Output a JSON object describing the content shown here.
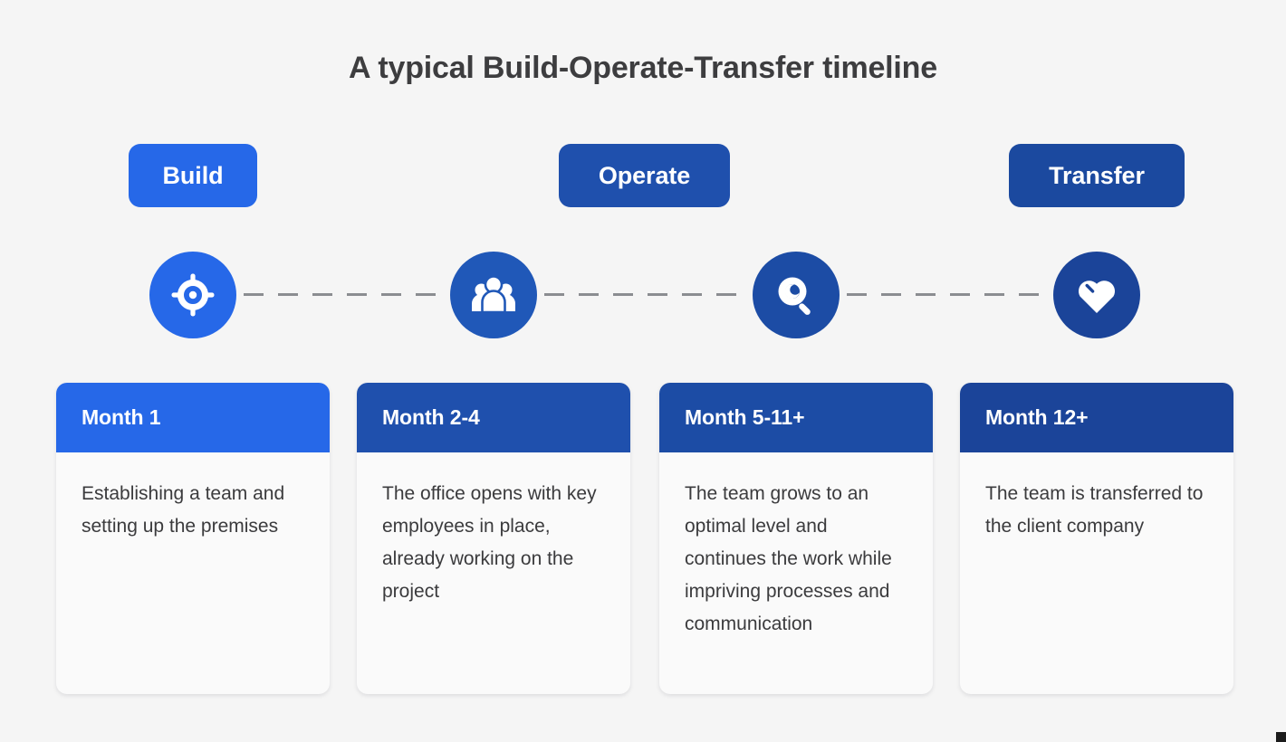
{
  "page": {
    "title": "A typical Build-Operate-Transfer timeline",
    "background_color": "#f5f5f5"
  },
  "phases": [
    {
      "label": "Build",
      "color": "#2668e8"
    },
    {
      "label": "Operate",
      "color": "#1f50ad"
    },
    {
      "label": "Transfer",
      "color": "#1b499f"
    }
  ],
  "timeline": {
    "connector_color": "#8b8d91",
    "connector_style": "dashed",
    "nodes": [
      {
        "icon": "target-icon",
        "color": "#2668e8"
      },
      {
        "icon": "people-group-icon",
        "color": "#2058b8"
      },
      {
        "icon": "magnifier-eye-icon",
        "color": "#1c4ca5"
      },
      {
        "icon": "heart-icon",
        "color": "#1b4499"
      }
    ]
  },
  "cards": [
    {
      "heading": "Month 1",
      "body": "Establishing a team and setting up the premises",
      "header_color": "#2668e8"
    },
    {
      "heading": "Month 2-4",
      "body": "The office opens with key employees in place, already working on the project",
      "header_color": "#1f50ad"
    },
    {
      "heading": "Month 5-11+",
      "body": "The team grows to an optimal level and continues the work while impriving processes and communication",
      "header_color": "#1c4ca5"
    },
    {
      "heading": "Month 12+",
      "body": "The team is transferred to the client company",
      "header_color": "#1b4499"
    }
  ]
}
